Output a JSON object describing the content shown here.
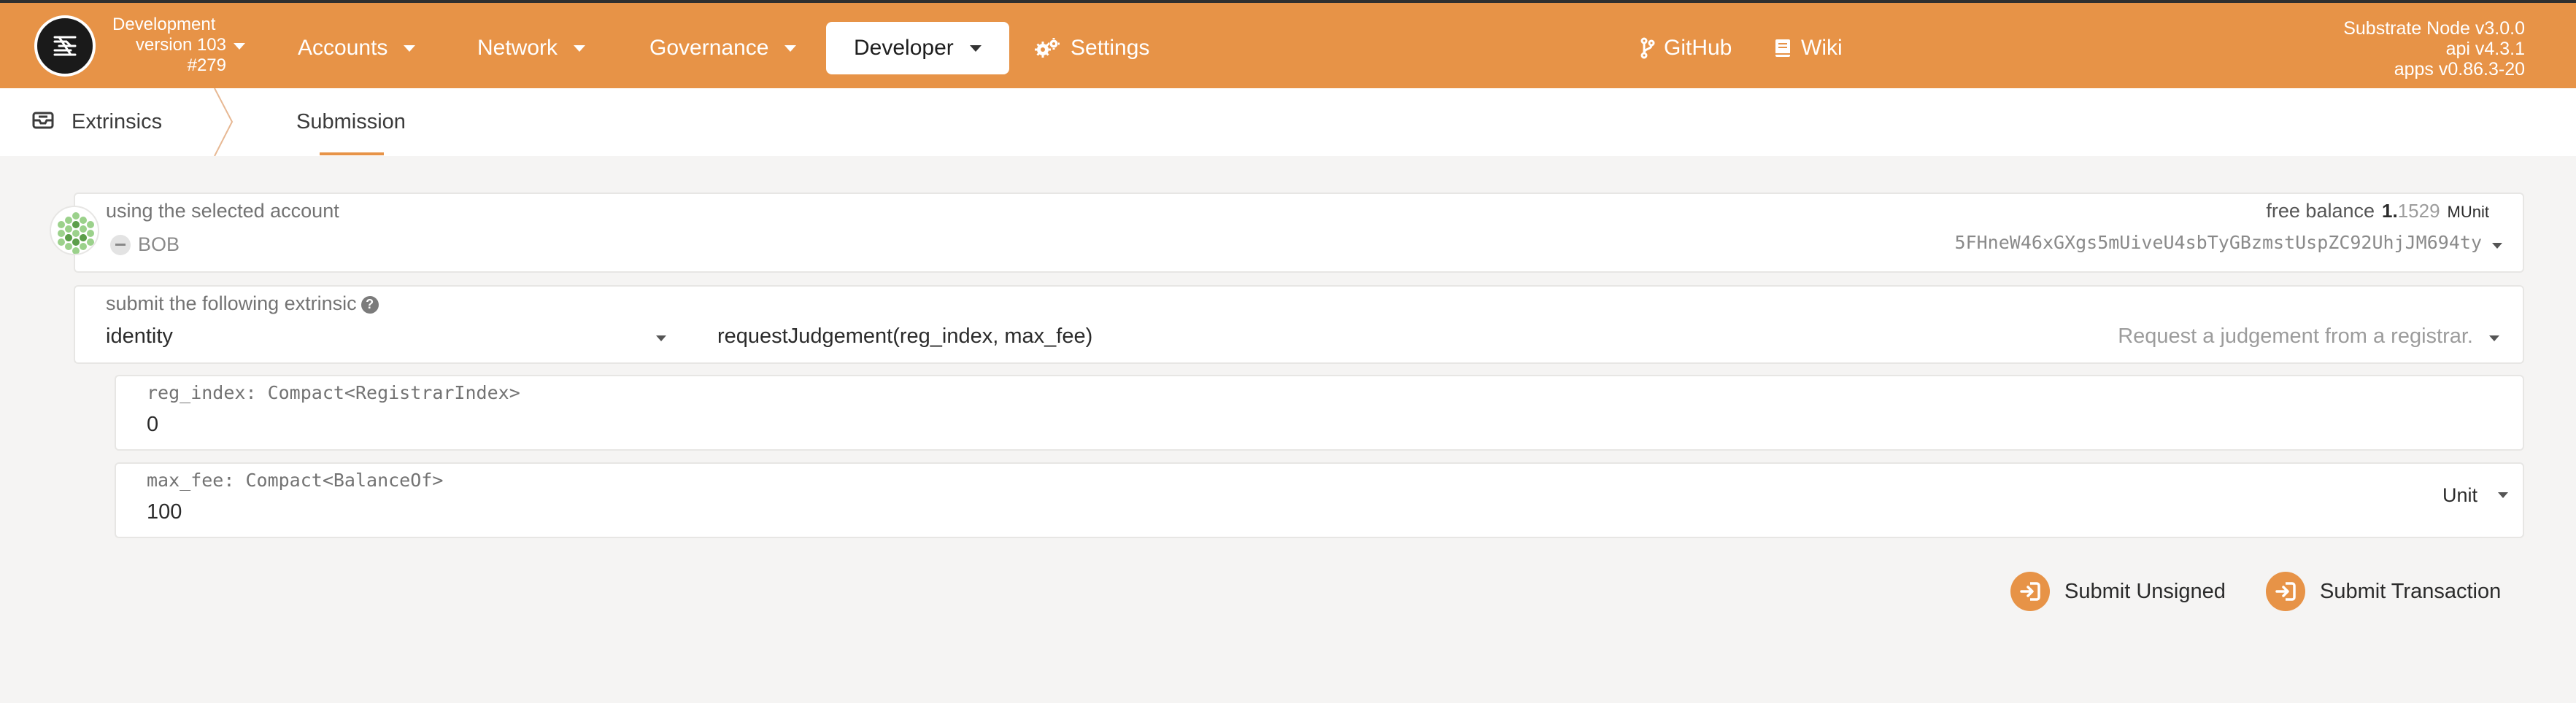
{
  "chain": {
    "name": "Development",
    "version": "version 103",
    "block": "#279"
  },
  "nav": {
    "accounts": "Accounts",
    "network": "Network",
    "governance": "Governance",
    "developer": "Developer",
    "settings": "Settings",
    "github": "GitHub",
    "wiki": "Wiki"
  },
  "node": {
    "line1": "Substrate Node v3.0.0",
    "line2": "api v4.3.1",
    "line3": "apps v0.86.3-20"
  },
  "tabs": {
    "root": "Extrinsics",
    "active": "Submission"
  },
  "account": {
    "label": "using the selected account",
    "name": "BOB",
    "balance_label": "free balance",
    "balance_int": "1.",
    "balance_dec": "1529",
    "balance_unit": "MUnit",
    "address": "5FHneW46xGXgs5mUiveU4sbTyGBzmstUspZC92UhjJM694ty"
  },
  "extrinsic": {
    "label": "submit the following extrinsic",
    "module": "identity",
    "method": "requestJudgement(reg_index, max_fee)",
    "description": "Request a judgement from a registrar."
  },
  "params": {
    "reg_index_label": "reg_index: Compact<RegistrarIndex>",
    "reg_index_value": "0",
    "max_fee_label": "max_fee: Compact<BalanceOf>",
    "max_fee_value": "100",
    "max_fee_unit": "Unit"
  },
  "actions": {
    "submit_unsigned": "Submit Unsigned",
    "submit_transaction": "Submit Transaction"
  },
  "colors": {
    "accent": "#e79347",
    "topbar_border": "#2f2f2f",
    "background": "#f5f4f3"
  },
  "icons": {
    "logo": "substrate-logo-icon",
    "settings": "gears-icon",
    "github": "code-branch-icon",
    "wiki": "book-icon",
    "extrinsics": "inbox-icon",
    "submit": "sign-in-icon"
  }
}
